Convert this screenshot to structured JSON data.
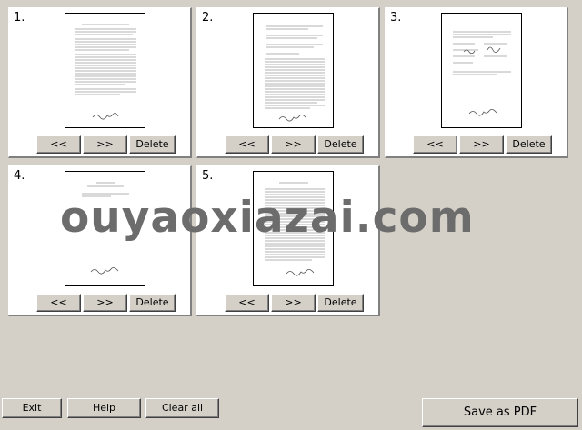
{
  "pages": [
    {
      "number": "1.",
      "prev_label": "<<",
      "next_label": ">>",
      "delete_label": "Delete"
    },
    {
      "number": "2.",
      "prev_label": "<<",
      "next_label": ">>",
      "delete_label": "Delete"
    },
    {
      "number": "3.",
      "prev_label": "<<",
      "next_label": ">>",
      "delete_label": "Delete"
    },
    {
      "number": "4.",
      "prev_label": "<<",
      "next_label": ">>",
      "delete_label": "Delete"
    },
    {
      "number": "5.",
      "prev_label": "<<",
      "next_label": ">>",
      "delete_label": "Delete"
    }
  ],
  "toolbar": {
    "exit_label": "Exit",
    "help_label": "Help",
    "clear_label": "Clear all",
    "save_label": "Save as PDF"
  },
  "watermark": "ouyaoxiazai.com",
  "colors": {
    "background": "#d4d0c8",
    "card": "#ffffff",
    "watermark": "#6c6c6c"
  }
}
